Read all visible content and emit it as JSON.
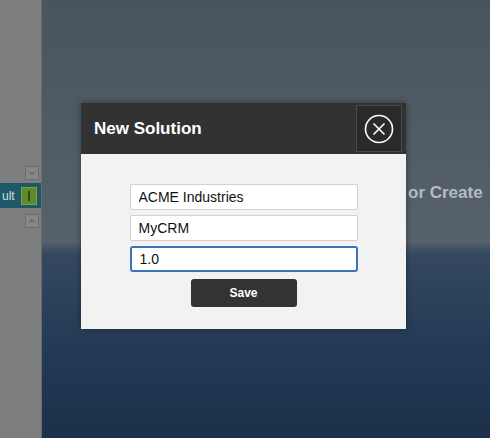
{
  "background": {
    "heading_fragment": "or Create"
  },
  "sidebar": {
    "items": [
      {
        "label": "ult",
        "selected": true
      }
    ]
  },
  "dialog": {
    "title": "New Solution",
    "fields": [
      {
        "value": "ACME Industries",
        "focused": false
      },
      {
        "value": "MyCRM",
        "focused": false
      },
      {
        "value": "1.0",
        "focused": true
      }
    ],
    "buttons": [
      "Save"
    ]
  }
}
